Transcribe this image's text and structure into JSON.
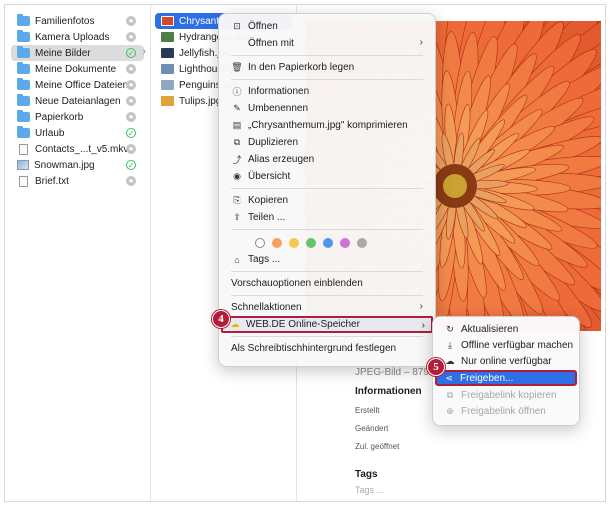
{
  "sidebar": {
    "items": [
      {
        "label": "Familienfotos",
        "kind": "folder",
        "status": "grey"
      },
      {
        "label": "Kamera Uploads",
        "kind": "folder",
        "status": "grey"
      },
      {
        "label": "Meine Bilder",
        "kind": "folder",
        "status": "green",
        "selected": true
      },
      {
        "label": "Meine Dokumente",
        "kind": "folder",
        "status": "grey"
      },
      {
        "label": "Meine Office Dateien",
        "kind": "folder",
        "status": "grey"
      },
      {
        "label": "Neue Dateianlagen",
        "kind": "folder",
        "status": "grey"
      },
      {
        "label": "Papierkorb",
        "kind": "folder",
        "status": "grey"
      },
      {
        "label": "Urlaub",
        "kind": "folder",
        "status": "green"
      },
      {
        "label": "Contacts_...t_v5.mkv",
        "kind": "doc",
        "status": "grey"
      },
      {
        "label": "Snowman.jpg",
        "kind": "image",
        "status": "green"
      },
      {
        "label": "Brief.txt",
        "kind": "doc",
        "status": "grey"
      }
    ]
  },
  "files": {
    "items": [
      {
        "label": "Chrysanthemum.jpg",
        "selected": true,
        "thumb_color": "#d9472a"
      },
      {
        "label": "Hydrangeas.jpg",
        "thumb_color": "#4f7d4a"
      },
      {
        "label": "Jellyfish.jpg",
        "thumb_color": "#2a3a55"
      },
      {
        "label": "Lighthouse.jpg",
        "thumb_color": "#6d8fb0"
      },
      {
        "label": "Penguins.jpg",
        "thumb_color": "#8fa7c0"
      },
      {
        "label": "Tulips.jpg",
        "thumb_color": "#e0a33a"
      }
    ],
    "first_visible": "Chrysanth"
  },
  "context_menu": {
    "open": "Öffnen",
    "open_with": "Öffnen mit",
    "trash": "In den Papierkorb legen",
    "info": "Informationen",
    "rename": "Umbenennen",
    "compress": "„Chrysanthemum.jpg\" komprimieren",
    "duplicate": "Duplizieren",
    "alias": "Alias erzeugen",
    "overview": "Übersicht",
    "copy": "Kopieren",
    "share": "Teilen ...",
    "tag_colors": [
      "#ffffff",
      "#f7a15c",
      "#f6c94a",
      "#63c46a",
      "#4f96ee",
      "#cf73d9",
      "#a9a9a9"
    ],
    "tags": "Tags ...",
    "preview_options": "Vorschauoptionen einblenden",
    "quick_actions": "Schnellaktionen",
    "webde": "WEB.DE Online-Speicher",
    "desktop_bg": "Als Schreibtischhintergrund festlegen"
  },
  "submenu": {
    "refresh": "Aktualisieren",
    "offline": "Offline verfügbar machen",
    "online_only": "Nur online verfügbar",
    "share": "Freigeben...",
    "copy_link": "Freigabelink kopieren",
    "open_link": "Freigabelink öffnen"
  },
  "preview": {
    "file_type": "JPEG-Bild – 879",
    "info_title": "Informationen",
    "created": "Erstellt",
    "modified": "Geändert",
    "opened": "Zul. geöffnet",
    "tags_title": "Tags",
    "tags_placeholder": "Tags ..."
  },
  "annotations": {
    "step4": "4",
    "step5": "5"
  },
  "colors": {
    "accent": "#2f6fe6",
    "highlight": "#b01e3b"
  }
}
